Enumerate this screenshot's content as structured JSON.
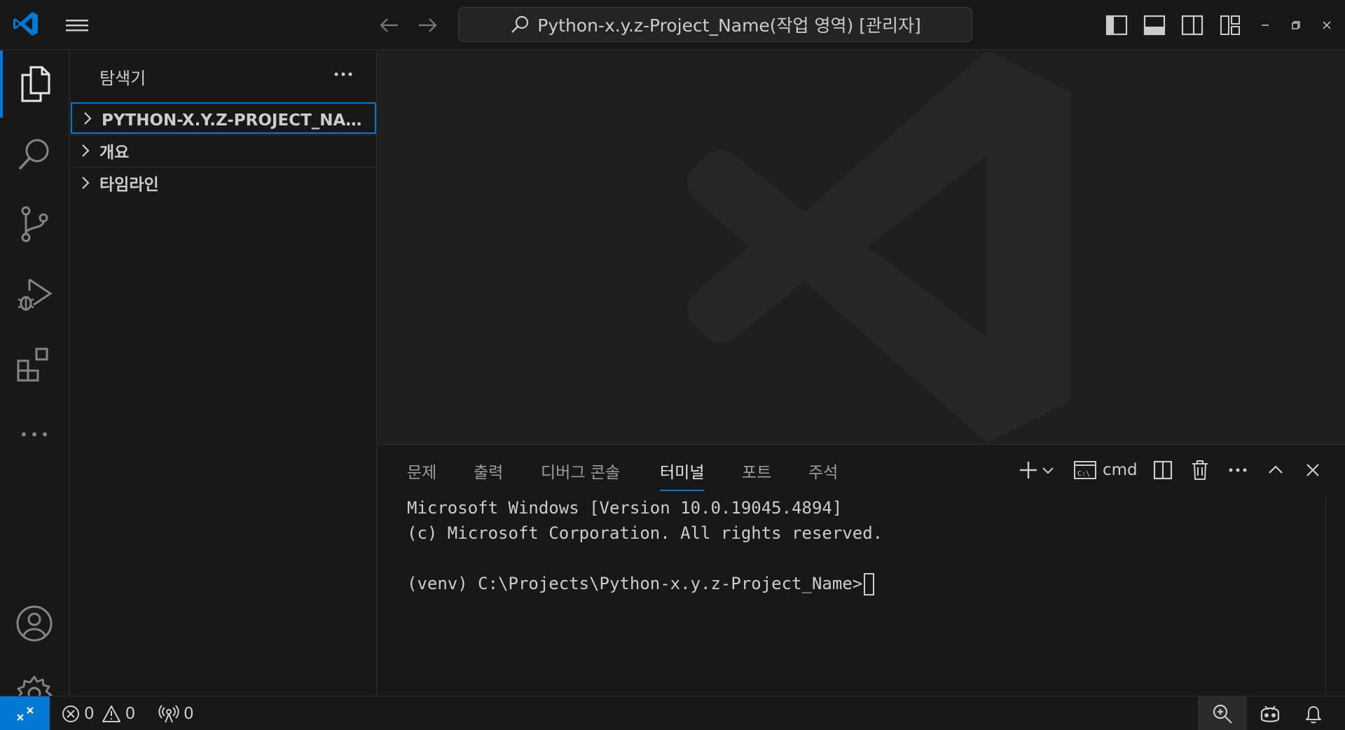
{
  "titlebar": {
    "search_text": "Python-x.y.z-Project_Name(작업 영역) [관리자]"
  },
  "icons": {
    "logo": "vscode-logo-icon",
    "menu": "hamburger-menu-icon",
    "back": "arrow-left-icon",
    "forward": "arrow-right-icon",
    "search": "search-icon",
    "toggle_sidebar": "toggle-primary-sidebar-icon",
    "toggle_panel": "toggle-panel-icon",
    "toggle_secondary": "toggle-secondary-sidebar-icon",
    "customize_layout": "customize-layout-icon",
    "minimize": "minimize-icon",
    "restore": "restore-icon",
    "close": "close-icon"
  },
  "activitybar": {
    "items": [
      "explorer-icon",
      "search-icon",
      "source-control-icon",
      "run-debug-icon",
      "extensions-icon",
      "more-icon"
    ],
    "bottom": [
      "account-icon",
      "settings-gear-icon"
    ]
  },
  "sidebar": {
    "title": "탐색기",
    "sections": [
      {
        "label": "PYTHON-X.Y.Z-PROJECT_NAME(작..."
      },
      {
        "label": "개요"
      },
      {
        "label": "타임라인"
      }
    ]
  },
  "panel": {
    "tabs": [
      "문제",
      "출력",
      "디버그 콘솔",
      "터미널",
      "포트",
      "주석"
    ],
    "active_tab": "터미널",
    "shell_label": "cmd",
    "terminal_lines": [
      "Microsoft Windows [Version 10.0.19045.4894]",
      "(c) Microsoft Corporation. All rights reserved.",
      "",
      "(venv) C:\\Projects\\Python-x.y.z-Project_Name>"
    ]
  },
  "statusbar": {
    "errors": "0",
    "warnings": "0",
    "ports": "0"
  },
  "colors": {
    "accent": "#0078d4",
    "background": "#1f1f1f",
    "chrome": "#181818"
  }
}
